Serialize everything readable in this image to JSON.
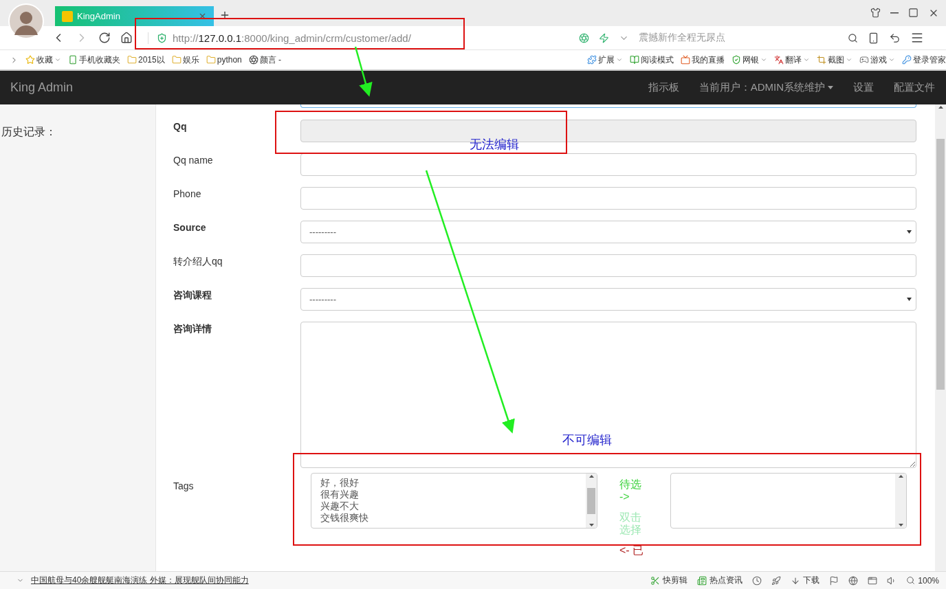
{
  "browser": {
    "tab": {
      "title": "KingAdmin",
      "selected": true
    },
    "address": {
      "scheme": "http://",
      "host": "127.0.0.1",
      "path": ":8000/king_admin/crm/customer/add/"
    },
    "search": {
      "placeholder": "震撼新作全程无尿点"
    },
    "bookmarks": [
      {
        "label": "收藏",
        "kind": "star",
        "caret": true
      },
      {
        "label": "手机收藏夹",
        "kind": "phone",
        "caret": false
      },
      {
        "label": "2015以",
        "kind": "folder",
        "caret": false
      },
      {
        "label": "娱乐",
        "kind": "folder",
        "caret": false
      },
      {
        "label": "python",
        "kind": "folder",
        "caret": false
      },
      {
        "label": "颜言 -",
        "kind": "glyph",
        "caret": false
      }
    ],
    "tools": [
      {
        "label": "扩展",
        "kind": "extension",
        "caret": true
      },
      {
        "label": "阅读模式",
        "kind": "reader",
        "caret": false
      },
      {
        "label": "我的直播",
        "kind": "live",
        "caret": false
      },
      {
        "label": "网银",
        "kind": "bank",
        "caret": true
      },
      {
        "label": "翻译",
        "kind": "translate",
        "caret": true
      },
      {
        "label": "截图",
        "kind": "screenshot",
        "caret": true
      },
      {
        "label": "游戏",
        "kind": "game",
        "caret": true
      },
      {
        "label": "登录管家",
        "kind": "login",
        "caret": false
      }
    ]
  },
  "navbar": {
    "brand": "King Admin",
    "links": [
      {
        "label": "指示板",
        "dropdown": false
      },
      {
        "label": "当前用户：ADMIN系统维护",
        "dropdown": true
      },
      {
        "label": "设置",
        "dropdown": false
      },
      {
        "label": "配置文件",
        "dropdown": false
      }
    ]
  },
  "sidebar": {
    "title": "历史记录："
  },
  "form": {
    "fields": [
      {
        "label": "Qq",
        "bold": true,
        "kind": "text",
        "disabled": true
      },
      {
        "label": "Qq name",
        "bold": false,
        "kind": "text",
        "disabled": false
      },
      {
        "label": "Phone",
        "bold": false,
        "kind": "text",
        "disabled": false
      },
      {
        "label": "Source",
        "bold": true,
        "kind": "select",
        "disabled": false,
        "value": "---------"
      },
      {
        "label": "转介绍人qq",
        "bold": false,
        "kind": "text",
        "disabled": false
      },
      {
        "label": "咨询课程",
        "bold": true,
        "kind": "select",
        "disabled": false,
        "value": "---------"
      },
      {
        "label": "咨询详情",
        "bold": true,
        "kind": "textarea",
        "disabled": false
      },
      {
        "label": "Tags",
        "bold": false,
        "kind": "multiselect",
        "disabled": false,
        "options": [
          "好，很好",
          "很有兴趣",
          "兴趣不大",
          "交钱很爽快"
        ],
        "actions": [
          {
            "label": "待选 ->",
            "kind": "available"
          },
          {
            "label": "双击选择",
            "kind": "hint"
          },
          {
            "label": "<- 已",
            "kind": "chosen"
          }
        ]
      }
    ]
  },
  "annotations": [
    {
      "text": "无法编辑"
    },
    {
      "text": "不可编辑"
    }
  ],
  "status_bar": {
    "news": "中国航母与40余艘舰艇南海演练 外媒：展现舰队间协同能力",
    "items": [
      {
        "label": "快剪辑",
        "kind": "clip"
      },
      {
        "label": "热点资讯",
        "kind": "news"
      },
      {
        "label": "下载",
        "kind": "download"
      }
    ],
    "zoom": "100%"
  }
}
